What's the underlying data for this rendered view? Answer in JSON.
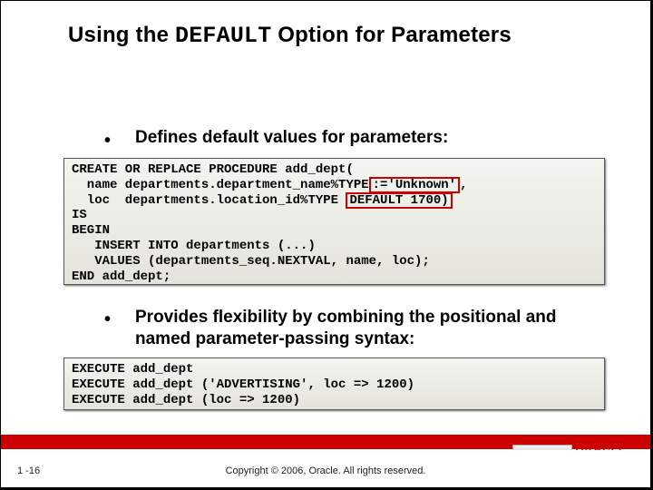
{
  "title": {
    "prefix": "Using the ",
    "mono": "DEFAULT",
    "suffix": " Option for Parameters"
  },
  "bullets": {
    "b1": "Defines default values for parameters:",
    "b2": "Provides flexibility by combining the positional and named parameter-passing syntax:"
  },
  "code1": {
    "l1": "CREATE OR REPLACE PROCEDURE add_dept(",
    "l2a": "  name departments.department_name%TYPE",
    "l2hl": ":='Unknown'",
    "l2b": ",",
    "l3a": "  loc  departments.location_id%TYPE ",
    "l3hl": "DEFAULT 1700)",
    "l4": "IS",
    "l5": "BEGIN",
    "l6": "   INSERT INTO departments (...)",
    "l7": "   VALUES (departments_seq.NEXTVAL, name, loc);",
    "l8": "END add_dept;"
  },
  "code2": {
    "l1": "EXECUTE add_dept",
    "l2": "EXECUTE add_dept ('ADVERTISING', loc => 1200)",
    "l3": "EXECUTE add_dept (loc => 1200)"
  },
  "footer": {
    "slide_num": "1 -16",
    "copyright": "Copyright © 2006, Oracle. All rights reserved.",
    "logo_word": "ORACLE"
  }
}
